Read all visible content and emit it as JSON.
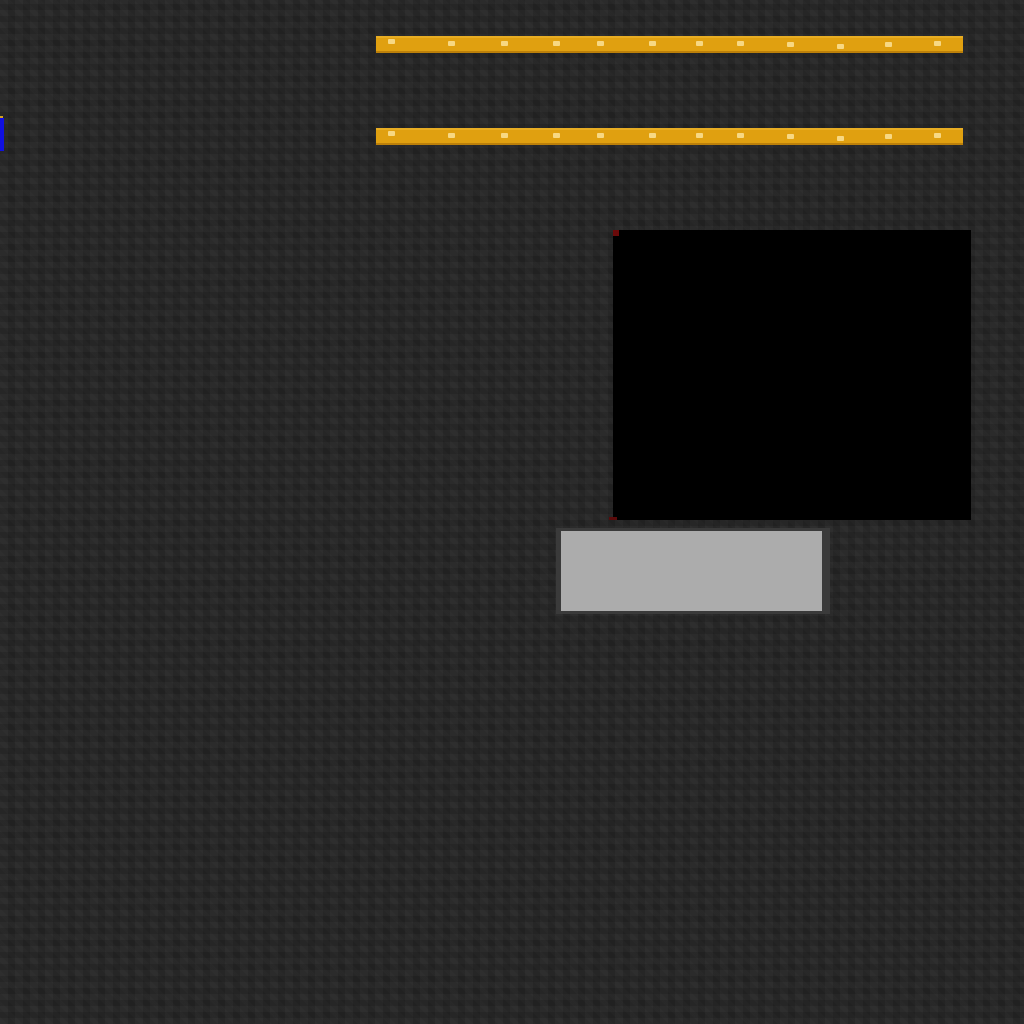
{
  "scene": {
    "background_color": "#232323",
    "strip_color": "#e0a010",
    "marker_color": "#1010e0",
    "panel_color": "#000000",
    "block_color": "#acacac",
    "strips": [
      {
        "name": "strip-top"
      },
      {
        "name": "strip-bottom"
      }
    ],
    "studs_per_strip": 12
  }
}
